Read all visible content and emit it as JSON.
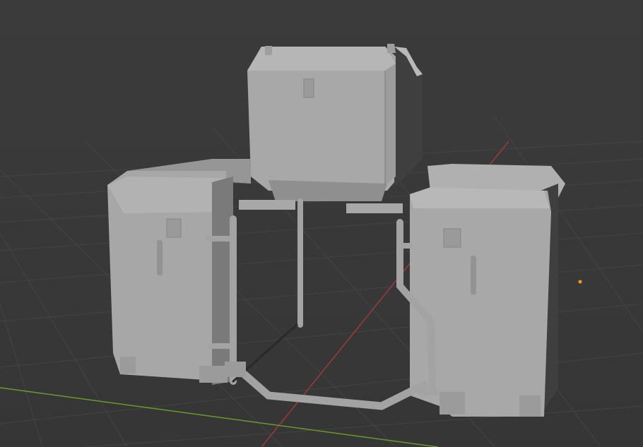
{
  "viewport": {
    "background": "#3a3a3a",
    "grid_color": "#444444",
    "x_axis_color": "#9e3a3a",
    "y_axis_color": "#6a9a2a",
    "light_color": "#ff9a1a"
  },
  "scene": {
    "objects": [
      "top-case",
      "left-pannier",
      "right-pannier",
      "mounting-rack"
    ],
    "shading": "solid",
    "material_color": "#a9a9a9"
  }
}
